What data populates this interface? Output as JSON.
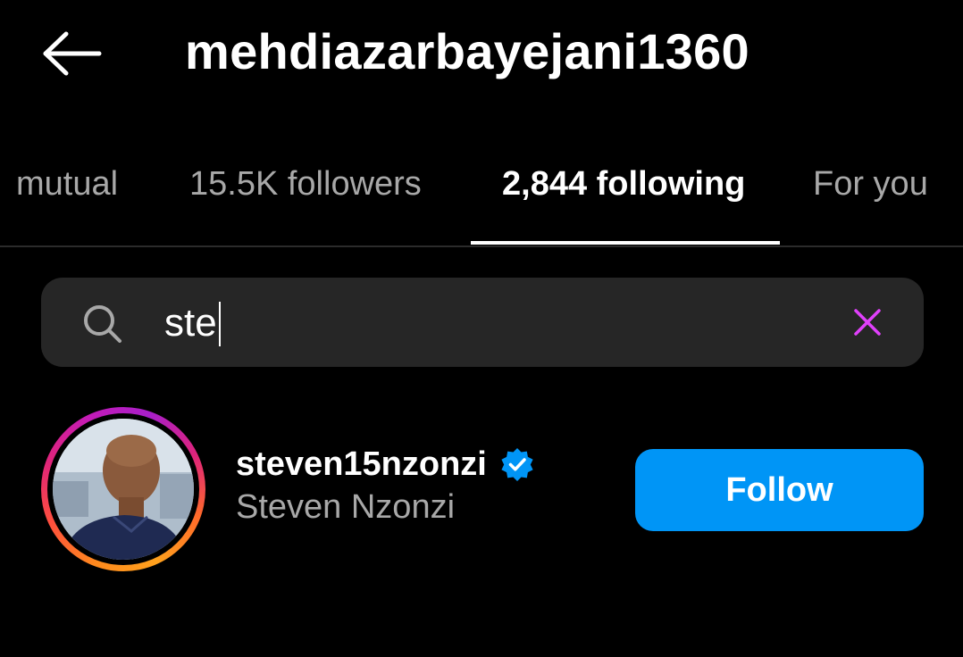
{
  "header": {
    "title": "mehdiazarbayejani1360",
    "back_icon": "arrow-left-icon"
  },
  "tabs": [
    {
      "label": "mutual",
      "active": false
    },
    {
      "label": "15.5K followers",
      "active": false
    },
    {
      "label": "2,844 following",
      "active": true
    },
    {
      "label": "For you",
      "active": false
    }
  ],
  "search": {
    "value": "ste",
    "search_icon": "search-icon",
    "clear_icon": "close-icon",
    "clear_icon_color": "#e040fb"
  },
  "results": [
    {
      "username": "steven15nzonzi",
      "full_name": "Steven Nzonzi",
      "verified": true,
      "has_story_ring": true,
      "follow_label": "Follow"
    }
  ],
  "colors": {
    "background": "#000000",
    "search_bg": "#262626",
    "follow_button": "#0095f6",
    "verified_badge": "#0095f6",
    "secondary_text": "#a8a8a8"
  }
}
